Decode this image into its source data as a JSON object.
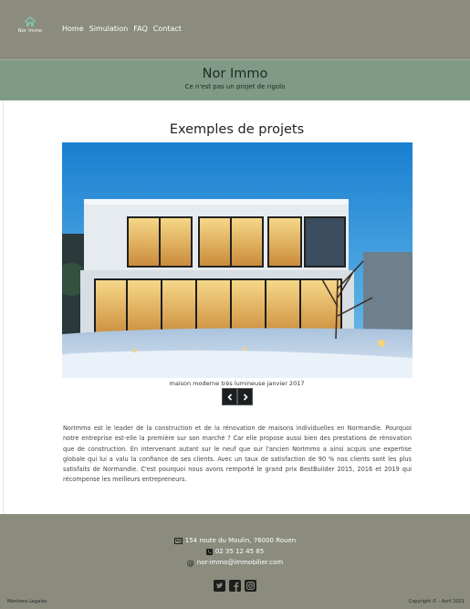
{
  "nav": {
    "logo_text": "Nor Immo",
    "links": [
      "Home",
      "Simulation",
      "FAQ",
      "Contact"
    ]
  },
  "hero": {
    "title": "Nor Immo",
    "tagline": "Ce n'est pas un projet de rigolo"
  },
  "projects": {
    "title": "Exemples de projets",
    "caption": "maison moderne très lumineuse janvier 2017",
    "prev_icon": "chevron-left-icon",
    "next_icon": "chevron-right-icon"
  },
  "intro": "NorImmo est le leader de la construction et de la rénovation de maisons individuelles en Normandie. Pourquoi notre entreprise est-elle la première sur son marché ? Car elle propose aussi bien des prestations de rénovation que de construction. En intervenant autant sur le neuf que sur l'ancien NorImmo a ainsi acquis une expertise globale qui lui a valu la confiance de ses clients. Avec un taux de satisfaction de 90 % nos clients sont les plus satisfaits de Normandie. C'est pourquoi nous avons remporté le grand prix BestBuilder 2015, 2016 et 2019 qui récompense les meilleurs entrepreneurs.",
  "footer": {
    "address": "154 route du Moulin, 76000 Rouen",
    "phone": "02 35 12 45 85",
    "email": "nor-immo@immobilier.com",
    "socials": [
      "twitter-icon",
      "facebook-icon",
      "instagram-icon"
    ],
    "legal": "Mentions Legales",
    "copyright": "Copyright © - Avril 2021"
  },
  "colors": {
    "navbar": "#8b8c7e",
    "hero": "#7f9a86",
    "footer": "#8b8c7e",
    "button": "#1b1f22"
  }
}
